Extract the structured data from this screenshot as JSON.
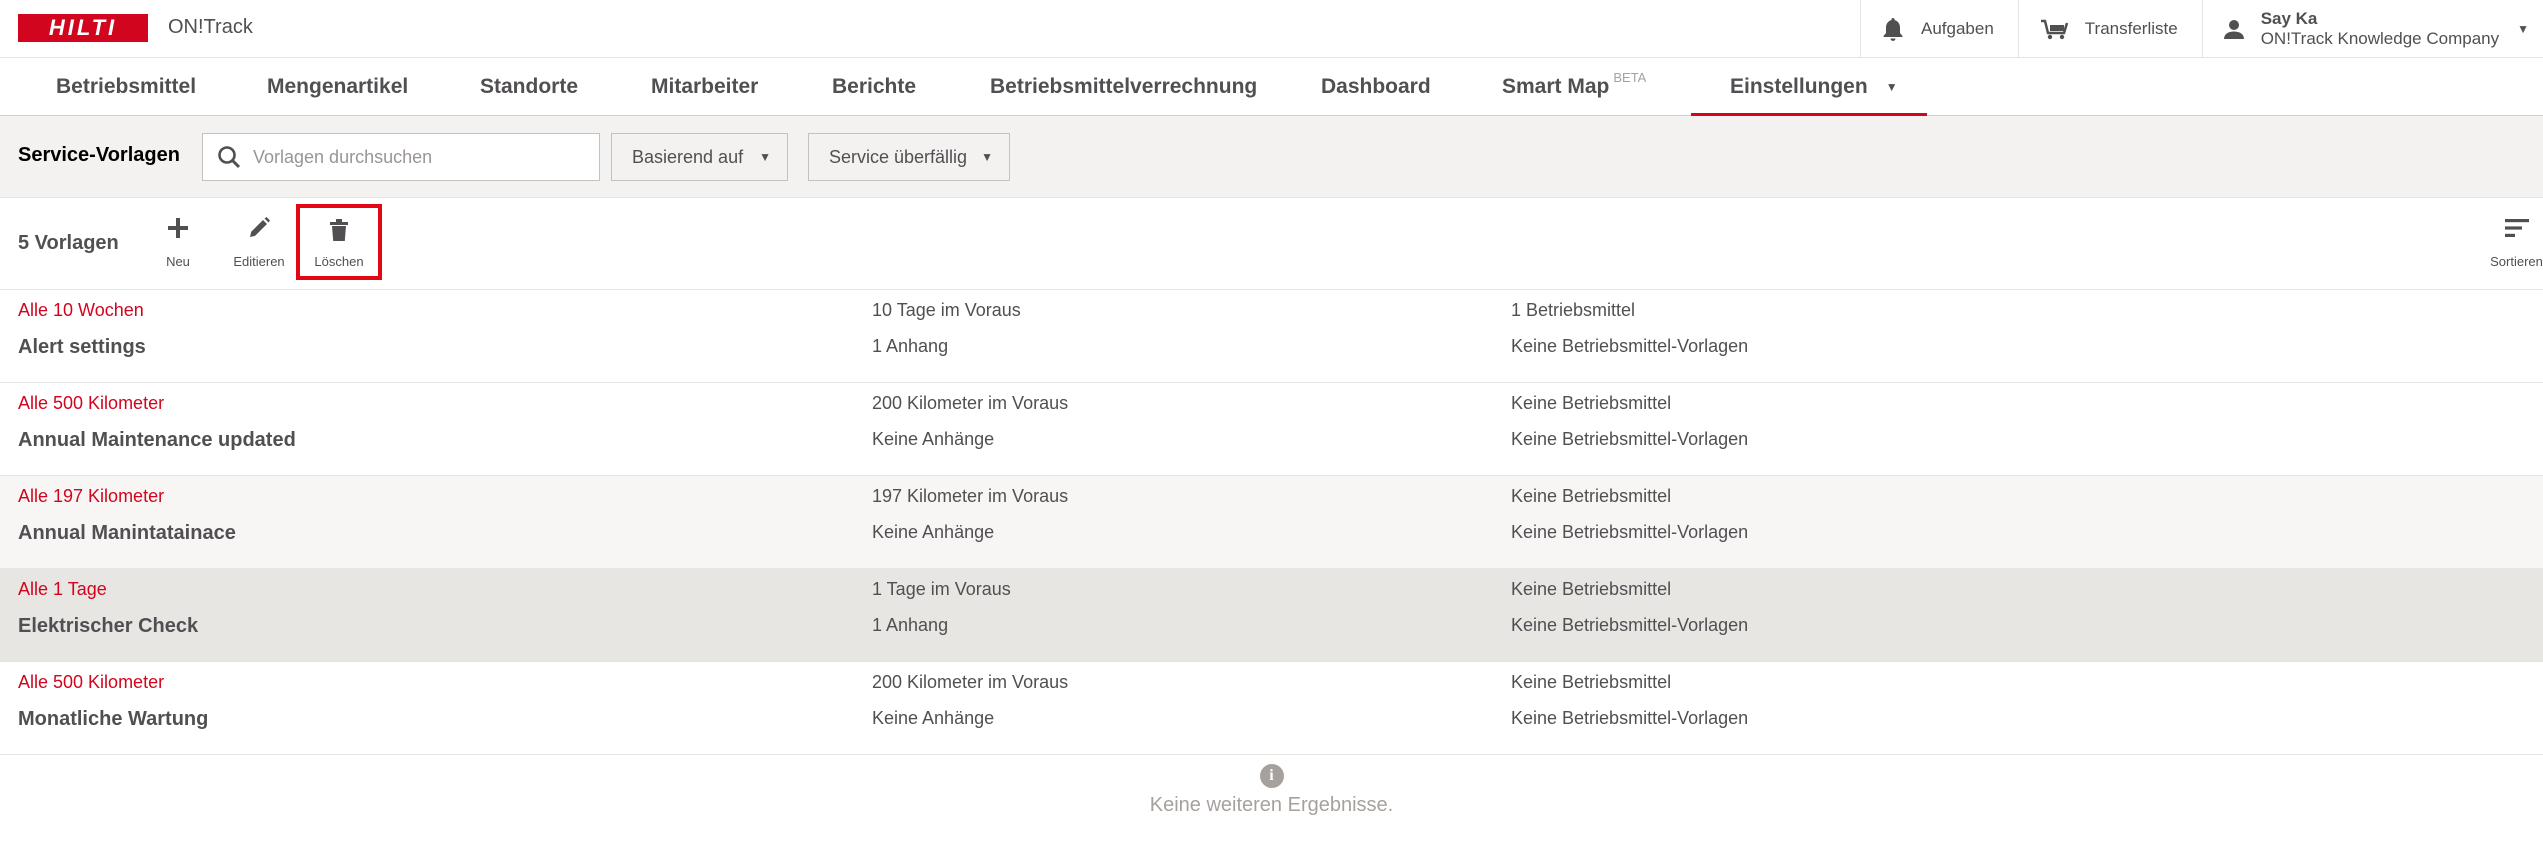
{
  "brand": {
    "logo_text": "HILTI",
    "app_name": "ON!Track",
    "accent": "#d2051e"
  },
  "header": {
    "tasks_label": "Aufgaben",
    "transfer_label": "Transferliste",
    "user_name": "Say Ka",
    "user_company": "ON!Track Knowledge Company"
  },
  "nav": {
    "items": [
      {
        "label": "Betriebsmittel"
      },
      {
        "label": "Mengenartikel"
      },
      {
        "label": "Standorte"
      },
      {
        "label": "Mitarbeiter"
      },
      {
        "label": "Berichte"
      },
      {
        "label": "Betriebsmittelverrechnung"
      },
      {
        "label": "Dashboard"
      },
      {
        "label": "Smart Map",
        "badge": "BETA"
      },
      {
        "label": "Einstellungen",
        "active": true
      }
    ]
  },
  "filter": {
    "title": "Service-Vorlagen",
    "search_placeholder": "Vorlagen durchsuchen",
    "dropdown_based_on": "Basierend auf",
    "dropdown_overdue": "Service überfällig"
  },
  "toolbar": {
    "count_label": "5 Vorlagen",
    "new_label": "Neu",
    "edit_label": "Editieren",
    "delete_label": "Löschen",
    "sort_label": "Sortieren"
  },
  "rows": [
    {
      "interval": "Alle 10 Wochen",
      "name": "Alert settings",
      "advance": "10 Tage im Voraus",
      "attachments": "1 Anhang",
      "assets": "1 Betriebsmittel",
      "templates": "Keine Betriebsmittel-Vorlagen"
    },
    {
      "interval": "Alle 500 Kilometer",
      "name": "Annual Maintenance updated",
      "advance": "200 Kilometer im Voraus",
      "attachments": "Keine Anhänge",
      "assets": "Keine Betriebsmittel",
      "templates": "Keine Betriebsmittel-Vorlagen"
    },
    {
      "interval": "Alle 197 Kilometer",
      "name": "Annual Manintatainace",
      "advance": "197 Kilometer im Voraus",
      "attachments": "Keine Anhänge",
      "assets": "Keine Betriebsmittel",
      "templates": "Keine Betriebsmittel-Vorlagen"
    },
    {
      "interval": "Alle 1 Tage",
      "name": "Elektrischer Check",
      "advance": "1 Tage im Voraus",
      "attachments": "1 Anhang",
      "assets": "Keine Betriebsmittel",
      "templates": "Keine Betriebsmittel-Vorlagen"
    },
    {
      "interval": "Alle 500 Kilometer",
      "name": "Monatliche Wartung",
      "advance": "200 Kilometer im Voraus",
      "attachments": "Keine Anhänge",
      "assets": "Keine Betriebsmittel",
      "templates": "Keine Betriebsmittel-Vorlagen"
    }
  ],
  "footer": {
    "info_glyph": "i",
    "no_more_results": "Keine weiteren Ergebnisse."
  }
}
